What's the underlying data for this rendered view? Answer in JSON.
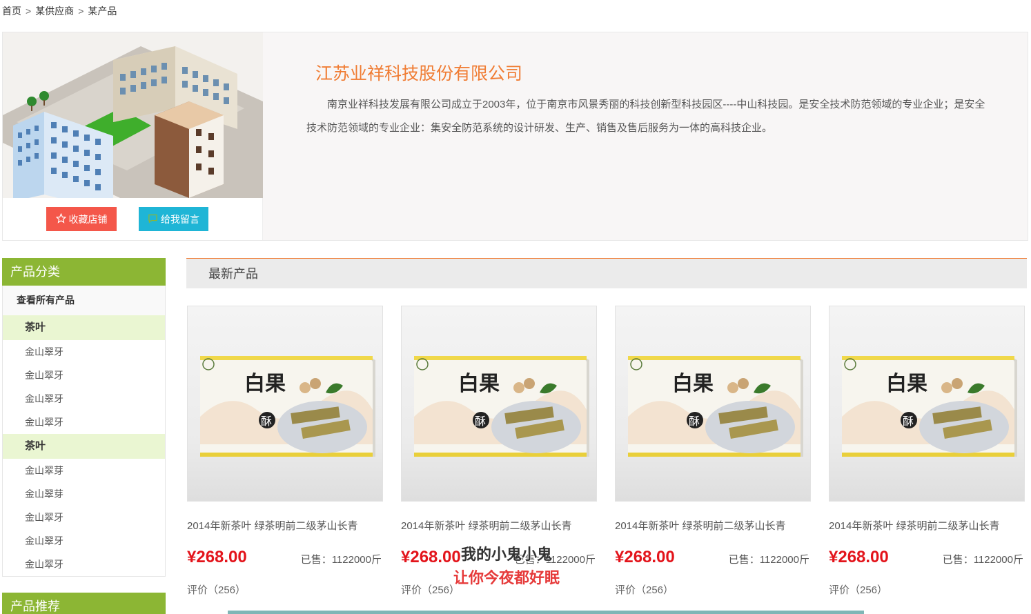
{
  "breadcrumb": [
    "首页",
    "某供应商",
    "某产品"
  ],
  "breadcrumb_sep": ">",
  "company": {
    "name": "江苏业祥科技股份有限公司",
    "description": "南京业祥科技发展有限公司成立于2003年，位于南京市风景秀丽的科技创新型科技园区----中山科技园。是安全技术防范领域的专业企业；是安全技术防范领域的专业企业：集安全防范系统的设计研发、生产、销售及售后服务为一体的高科技企业。",
    "fav_button": "收藏店铺",
    "msg_button": "给我留言"
  },
  "sidebar": {
    "title": "产品分类",
    "all_label": "查看所有产品",
    "groups": [
      {
        "category": "茶叶",
        "items": [
          "金山翠牙",
          "金山翠牙",
          "金山翠牙",
          "金山翠牙"
        ]
      },
      {
        "category": "茶叶",
        "items": [
          "金山翠芽",
          "金山翠芽",
          "金山翠牙",
          "金山翠牙",
          "金山翠牙"
        ]
      }
    ],
    "recommend_title": "产品推荐"
  },
  "main": {
    "section_title": "最新产品",
    "products": [
      {
        "title": "2014年新茶叶 绿茶明前二级茅山长青",
        "price": "¥268.00",
        "sold": "已售：1122000斤",
        "review": "评价（256）",
        "box_text_big": "白果",
        "box_text_small": "酥"
      },
      {
        "title": "2014年新茶叶 绿茶明前二级茅山长青",
        "price": "¥268.00",
        "sold": "已售：1122000斤",
        "review": "评价（256）",
        "box_text_big": "白果",
        "box_text_small": "酥"
      },
      {
        "title": "2014年新茶叶 绿茶明前二级茅山长青",
        "price": "¥268.00",
        "sold": "已售：1122000斤",
        "review": "评价（256）",
        "box_text_big": "白果",
        "box_text_small": "酥"
      },
      {
        "title": "2014年新茶叶 绿茶明前二级茅山长青",
        "price": "¥268.00",
        "sold": "已售：1122000斤",
        "review": "评价（256）",
        "box_text_big": "白果",
        "box_text_small": "酥"
      }
    ]
  },
  "overlay": {
    "line1": "我的小鬼小鬼",
    "line2": "让你今夜都好眠"
  },
  "colors": {
    "accent_orange": "#f07c33",
    "price_red": "#e3141b",
    "sidebar_green": "#8cb634",
    "fav_red": "#f4574a",
    "msg_cyan": "#1fb5d6"
  }
}
